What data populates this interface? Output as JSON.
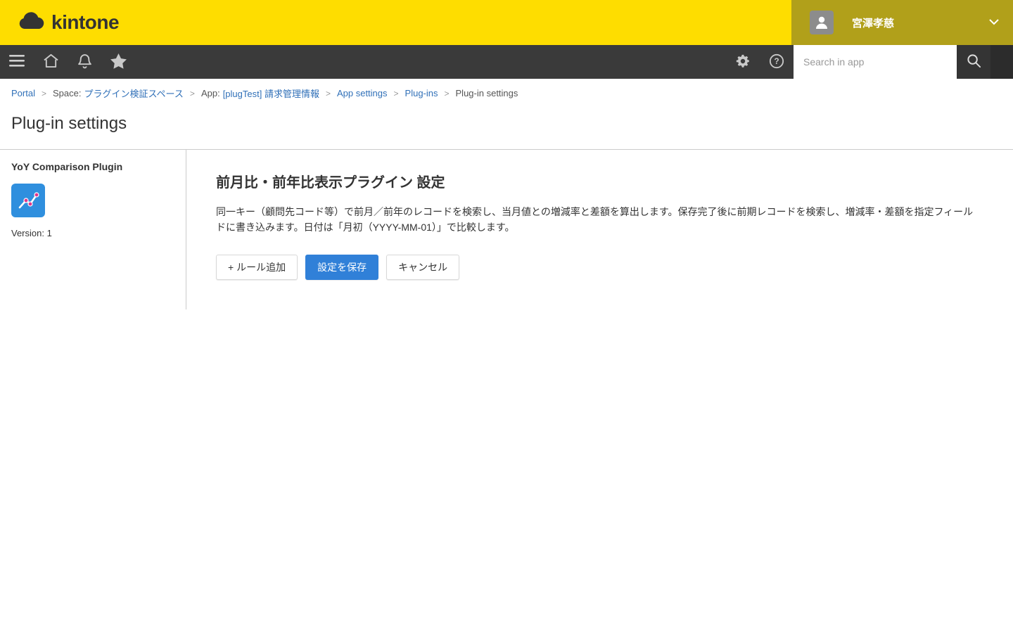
{
  "header": {
    "logo_text": "kintone",
    "user_name": "宮澤孝慈"
  },
  "nav": {
    "search_placeholder": "Search in app"
  },
  "breadcrumb": {
    "separator": ">",
    "portal": "Portal",
    "space_prefix": "Space:",
    "space_link": "プラグイン検証スペース",
    "app_prefix": "App:",
    "app_link": "[plugTest] 請求管理情報",
    "app_settings": "App settings",
    "plugins": "Plug-ins",
    "current": "Plug-in settings"
  },
  "page": {
    "title": "Plug-in settings"
  },
  "plugin_panel": {
    "name": "YoY Comparison Plugin",
    "version_label": "Version: 1"
  },
  "settings": {
    "heading": "前月比・前年比表示プラグイン 設定",
    "description": "同一キー（顧問先コード等）で前月／前年のレコードを検索し、当月値との増減率と差額を算出します。保存完了後に前期レコードを検索し、増減率・差額を指定フィールドに書き込みます。日付は「月初（YYYY-MM-01）」で比較します。",
    "buttons": {
      "add_rule": "+ ルール追加",
      "save": "設定を保存",
      "cancel": "キャンセル"
    }
  },
  "icons": {
    "kintone-cloud-icon": "cloud shape",
    "hamburger-menu-icon": "three bars",
    "home-icon": "house outline",
    "notifications-bell-icon": "bell outline",
    "favorites-star-icon": "filled star",
    "gear-icon": "settings gear",
    "help-icon": "question mark in circle",
    "search-icon": "magnifier",
    "user-avatar-icon": "person silhouette",
    "chevron-down-icon": "down chevron",
    "plugin-chart-icon": "trend line with dots"
  },
  "colors": {
    "brand_yellow": "#fedd00",
    "user_block": "#b1a01a",
    "nav_bar": "#3a3a3a",
    "primary_button": "#3080d8",
    "link_blue": "#3070b8",
    "plugin_icon_bg": "#2f8fde",
    "accent_dot": "#e0368c"
  }
}
